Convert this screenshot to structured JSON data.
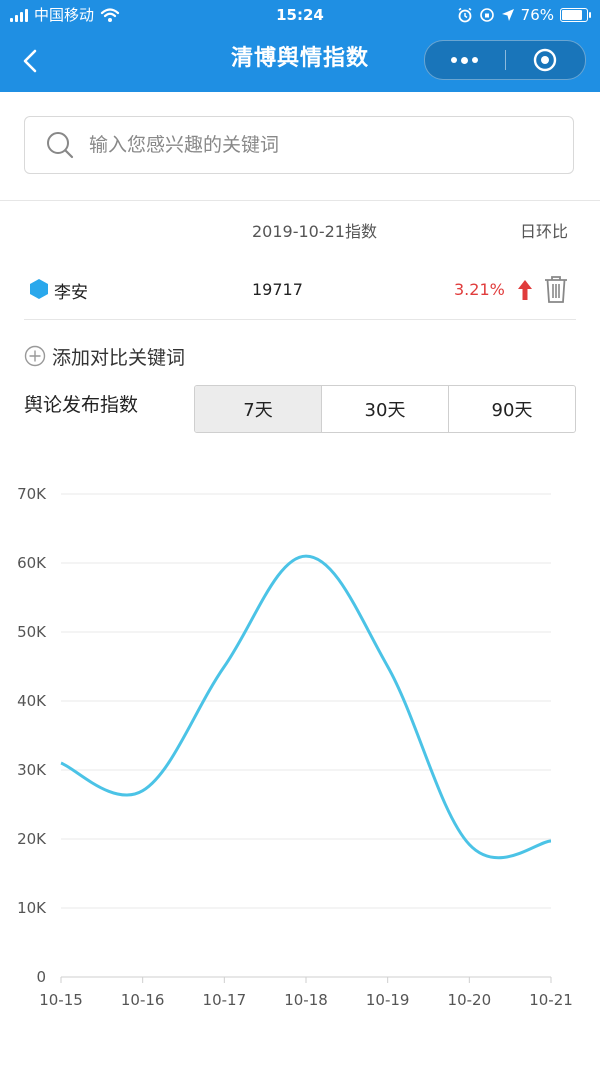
{
  "status_bar": {
    "carrier": "中国移动",
    "time": "15:24",
    "battery": "76%",
    "battery_level": 0.76
  },
  "nav": {
    "title": "清博舆情指数"
  },
  "search": {
    "placeholder": "输入您感兴趣的关键词",
    "value": ""
  },
  "index_table": {
    "date_header": "2019-10-21指数",
    "change_header": "日环比",
    "keyword": {
      "name": "李安",
      "value": "19717",
      "change_pct": "3.21%",
      "marker_color": "#2AA8EC",
      "change_color": "#E03C3C"
    }
  },
  "add_compare_label": "添加对比关键词",
  "publish_index_label": "舆论发布指数",
  "ranges": [
    {
      "label": "7天",
      "active": true
    },
    {
      "label": "30天",
      "active": false
    },
    {
      "label": "90天",
      "active": false
    }
  ],
  "colors": {
    "header_bg": "#1F8FE3",
    "line": "#4BC3E6",
    "grid": "#e8e8e8"
  },
  "chart_data": {
    "type": "line",
    "categories": [
      "10-15",
      "10-16",
      "10-17",
      "10-18",
      "10-19",
      "10-20",
      "10-21"
    ],
    "series": [
      {
        "values": [
          31000,
          27000,
          45000,
          61000,
          45000,
          19200,
          19717
        ]
      }
    ],
    "y_ticks": [
      "0",
      "10K",
      "20K",
      "30K",
      "40K",
      "50K",
      "60K",
      "70K"
    ],
    "ylim": [
      0,
      70000
    ],
    "grid": true,
    "title": "",
    "xlabel": "",
    "ylabel": ""
  }
}
